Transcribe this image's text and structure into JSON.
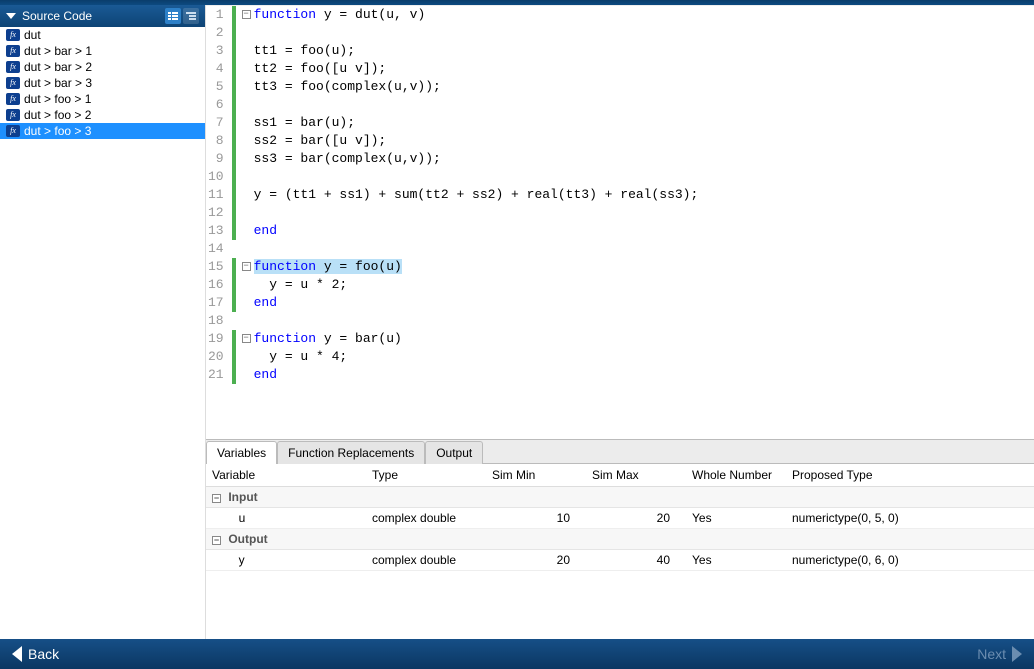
{
  "sidebar": {
    "title": "Source Code",
    "items": [
      {
        "label": "dut"
      },
      {
        "label": "dut > bar > 1"
      },
      {
        "label": "dut > bar > 2"
      },
      {
        "label": "dut > bar > 3"
      },
      {
        "label": "dut > foo > 1"
      },
      {
        "label": "dut > foo > 2"
      },
      {
        "label": "dut > foo > 3"
      }
    ],
    "selected": 6
  },
  "code": {
    "lines": [
      {
        "n": 1,
        "fold": true,
        "tokens": [
          {
            "t": "function ",
            "c": "kw"
          },
          {
            "t": "y = dut(u, v)"
          }
        ]
      },
      {
        "n": 2,
        "tokens": [
          {
            "t": ""
          }
        ]
      },
      {
        "n": 3,
        "tokens": [
          {
            "t": "tt1 = foo(u);"
          }
        ]
      },
      {
        "n": 4,
        "tokens": [
          {
            "t": "tt2 = foo([u v]);"
          }
        ]
      },
      {
        "n": 5,
        "tokens": [
          {
            "t": "tt3 = foo(complex(u,v));"
          }
        ]
      },
      {
        "n": 6,
        "tokens": [
          {
            "t": ""
          }
        ]
      },
      {
        "n": 7,
        "tokens": [
          {
            "t": "ss1 = bar(u);"
          }
        ]
      },
      {
        "n": 8,
        "tokens": [
          {
            "t": "ss2 = bar([u v]);"
          }
        ]
      },
      {
        "n": 9,
        "tokens": [
          {
            "t": "ss3 = bar(complex(u,v));"
          }
        ]
      },
      {
        "n": 10,
        "tokens": [
          {
            "t": ""
          }
        ]
      },
      {
        "n": 11,
        "tokens": [
          {
            "t": "y = (tt1 + ss1) + sum(tt2 + ss2) + real(tt3) + real(ss3);"
          }
        ]
      },
      {
        "n": 12,
        "tokens": [
          {
            "t": ""
          }
        ]
      },
      {
        "n": 13,
        "tokens": [
          {
            "t": "end",
            "c": "kw"
          }
        ],
        "dedent": true
      },
      {
        "n": 14,
        "nogreen": true,
        "tokens": [
          {
            "t": ""
          }
        ]
      },
      {
        "n": 15,
        "fold": true,
        "tokens": [
          {
            "t": "function ",
            "c": "kw",
            "hl": true
          },
          {
            "t": "y = foo(u)",
            "hl": true
          }
        ]
      },
      {
        "n": 16,
        "tokens": [
          {
            "t": "  y = u * 2;"
          }
        ]
      },
      {
        "n": 17,
        "tokens": [
          {
            "t": "end",
            "c": "kw"
          }
        ],
        "dedent": true
      },
      {
        "n": 18,
        "nogreen": true,
        "tokens": [
          {
            "t": ""
          }
        ]
      },
      {
        "n": 19,
        "fold": true,
        "tokens": [
          {
            "t": "function ",
            "c": "kw"
          },
          {
            "t": "y = bar(u)"
          }
        ]
      },
      {
        "n": 20,
        "tokens": [
          {
            "t": "  y = u * 4;"
          }
        ]
      },
      {
        "n": 21,
        "tokens": [
          {
            "t": "end",
            "c": "kw"
          }
        ],
        "dedent": true
      }
    ]
  },
  "tabs": {
    "items": [
      "Variables",
      "Function Replacements",
      "Output"
    ],
    "active": 0
  },
  "vartable": {
    "columns": [
      "Variable",
      "Type",
      "Sim Min",
      "Sim Max",
      "Whole Number",
      "Proposed Type"
    ],
    "groups": [
      {
        "name": "Input",
        "rows": [
          {
            "variable": "u",
            "type": "complex double",
            "simmin": "10",
            "simmax": "20",
            "whole": "Yes",
            "proposed": "numerictype(0, 5, 0)"
          }
        ]
      },
      {
        "name": "Output",
        "rows": [
          {
            "variable": "y",
            "type": "complex double",
            "simmin": "20",
            "simmax": "40",
            "whole": "Yes",
            "proposed": "numerictype(0, 6, 0)"
          }
        ]
      }
    ]
  },
  "footer": {
    "back": "Back",
    "next": "Next"
  }
}
